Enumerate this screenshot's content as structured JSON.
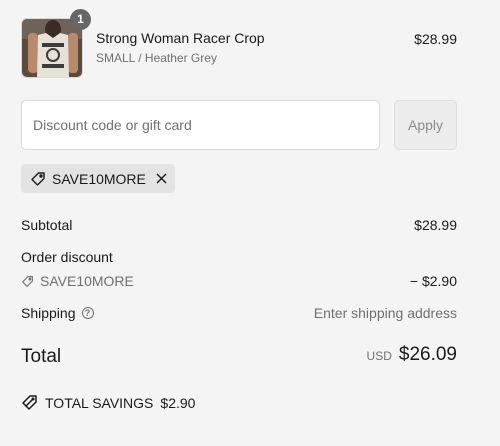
{
  "product": {
    "name": "Strong Woman Racer Crop",
    "variant": "SMALL / Heather Grey",
    "price": "$28.99",
    "quantity": "1",
    "image_text": "SHREDDED"
  },
  "discount": {
    "placeholder": "Discount code or gift card",
    "apply_label": "Apply",
    "applied_code": "SAVE10MORE"
  },
  "summary": {
    "subtotal_label": "Subtotal",
    "subtotal_value": "$28.99",
    "order_discount_label": "Order discount",
    "discount_code": "SAVE10MORE",
    "discount_value": "− $2.90",
    "shipping_label": "Shipping",
    "shipping_value": "Enter shipping address",
    "total_label": "Total",
    "currency": "USD",
    "total_value": "$26.09",
    "savings_label": "TOTAL SAVINGS",
    "savings_value": "$2.90"
  },
  "icons": {
    "tag": "tag-icon",
    "close": "close-icon",
    "help": "help-icon",
    "savings": "savings-tag-icon"
  },
  "colors": {
    "background": "#f4f4f4",
    "muted_text": "#707070",
    "badge": "#666666",
    "tag_bg": "#e3e3e3"
  }
}
